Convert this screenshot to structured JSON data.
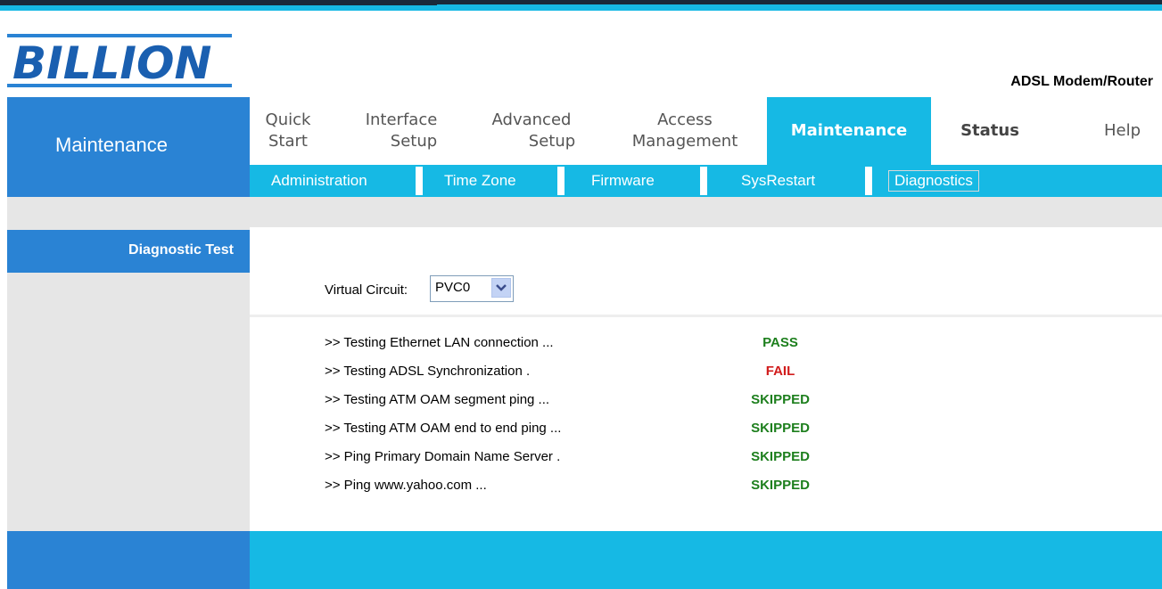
{
  "header": {
    "logo_text": "BILLION",
    "product": "ADSL Modem/Router"
  },
  "section": {
    "title": "Maintenance"
  },
  "menu": {
    "items": [
      {
        "line1": "Quick",
        "line2": "Start"
      },
      {
        "line1": "Interface",
        "line2": "Setup"
      },
      {
        "line1": "Advanced",
        "line2": "Setup"
      },
      {
        "line1": "Access",
        "line2": "Management"
      },
      {
        "line1": "Maintenance",
        "line2": ""
      },
      {
        "line1": "Status",
        "line2": ""
      },
      {
        "line1": "Help",
        "line2": ""
      }
    ],
    "active": "Maintenance"
  },
  "submenu": {
    "items": [
      "Administration",
      "Time Zone",
      "Firmware",
      "SysRestart",
      "Diagnostics"
    ],
    "active": "Diagnostics"
  },
  "sidebar": {
    "title": "Diagnostic Test"
  },
  "form": {
    "vc_label": "Virtual Circuit:",
    "vc_value": "PVC0"
  },
  "tests": [
    {
      "label": ">> Testing Ethernet LAN connection ...",
      "result": "PASS"
    },
    {
      "label": ">> Testing ADSL Synchronization .",
      "result": "FAIL"
    },
    {
      "label": ">> Testing ATM OAM segment ping ...",
      "result": "SKIPPED"
    },
    {
      "label": ">> Testing ATM OAM end to end ping ...",
      "result": "SKIPPED"
    },
    {
      "label": ">> Ping Primary Domain Name Server .",
      "result": "SKIPPED"
    },
    {
      "label": ">> Ping www.yahoo.com ...",
      "result": "SKIPPED"
    }
  ],
  "colors": {
    "accent_cyan": "#16b9e4",
    "accent_blue": "#2a83d4",
    "pass_green": "#1d7f1d",
    "fail_red": "#d11b1b"
  }
}
